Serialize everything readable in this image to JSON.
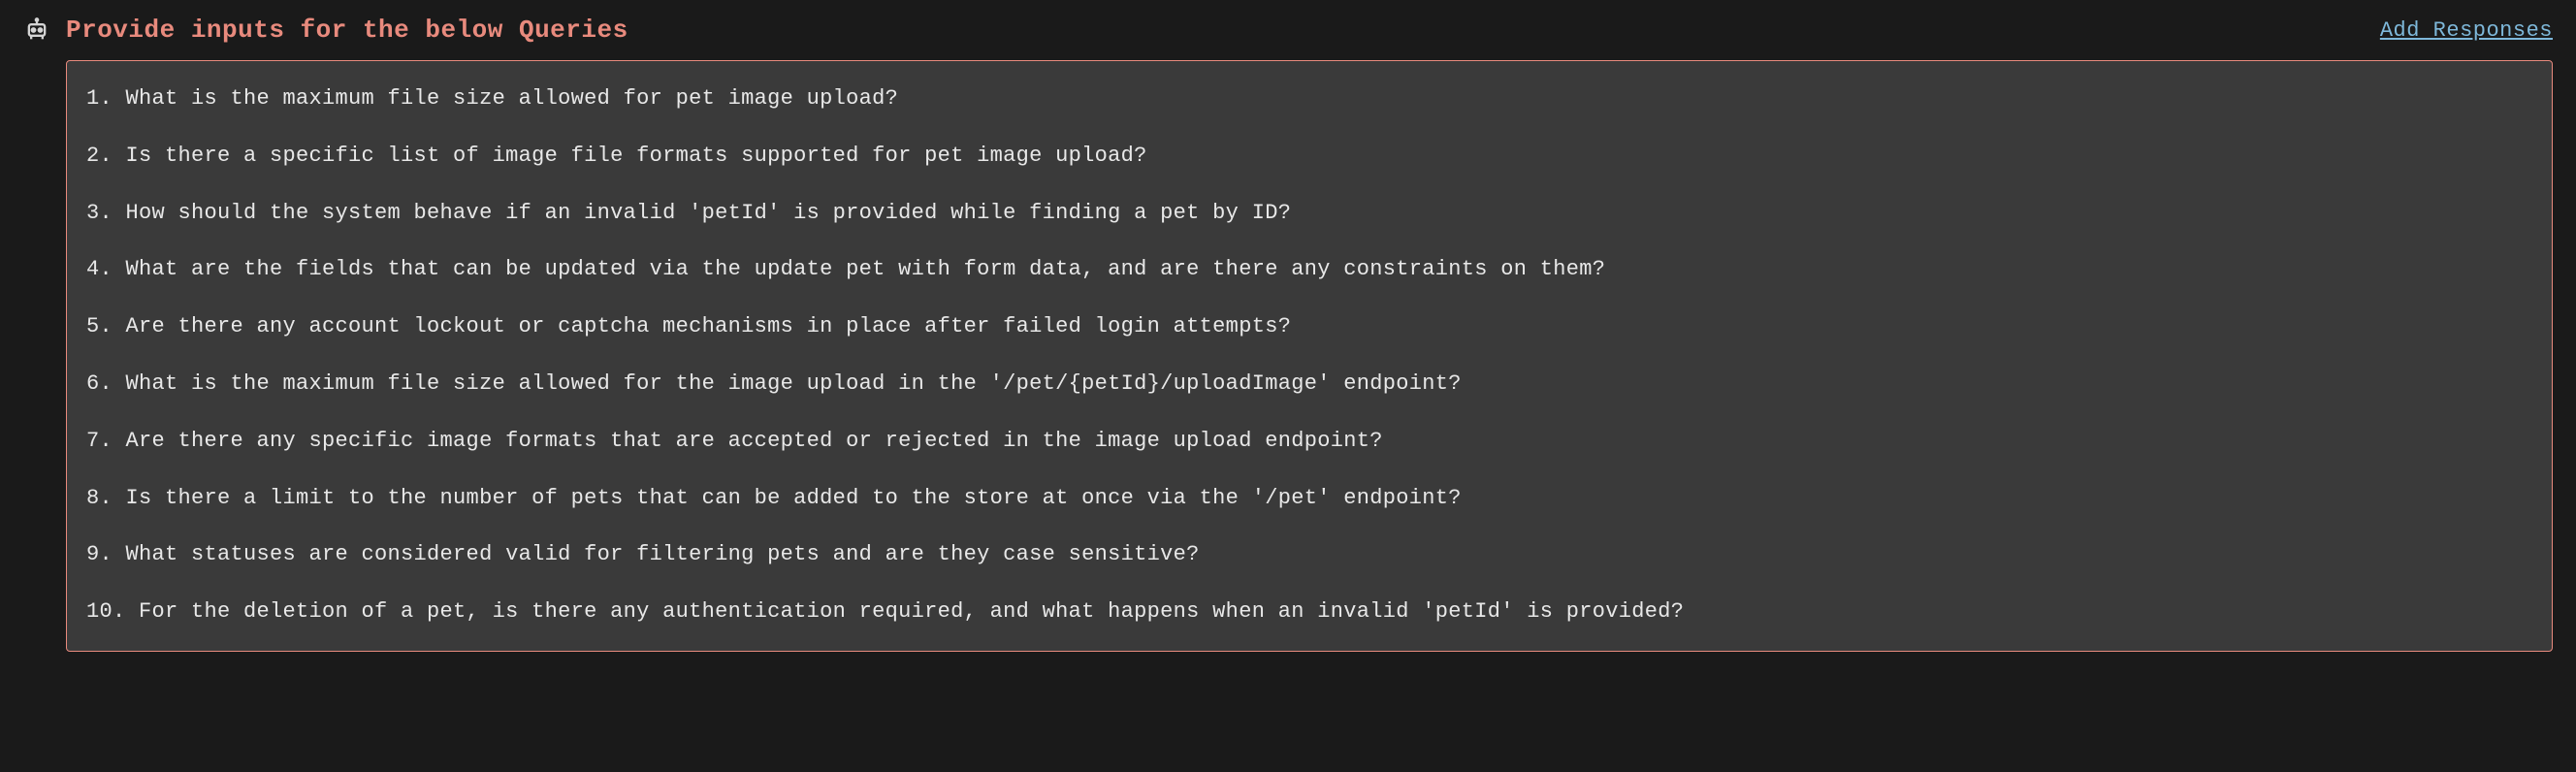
{
  "header": {
    "title": "Provide inputs for the below Queries",
    "action_link": "Add Responses"
  },
  "queries": [
    "1. What is the maximum file size allowed for pet image upload?",
    "2. Is there a specific list of image file formats supported for pet image upload?",
    "3. How should the system behave if an invalid 'petId' is provided while finding a pet by ID?",
    "4. What are the fields that can be updated via the update pet with form data, and are there any constraints on them?",
    "5. Are there any account lockout or captcha mechanisms in place after failed login attempts?",
    "6. What is the maximum file size allowed for the image upload in the '/pet/{petId}/uploadImage' endpoint?",
    "7. Are there any specific image formats that are accepted or rejected in the image upload endpoint?",
    "8. Is there a limit to the number of pets that can be added to the store at once via the '/pet' endpoint?",
    "9. What statuses are considered valid for filtering pets and are they case sensitive?",
    "10. For the deletion of a pet, is there any authentication required, and what happens when an invalid 'petId' is provided?"
  ]
}
